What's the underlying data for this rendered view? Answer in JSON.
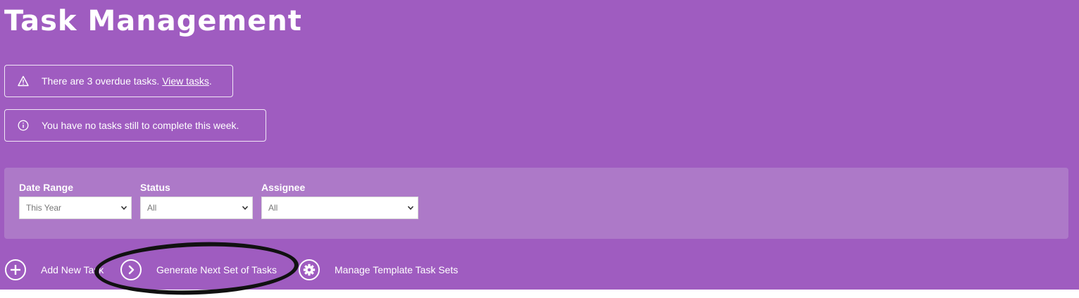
{
  "header": {
    "title": "Task Management"
  },
  "alerts": {
    "overdue": {
      "prefix": "There are 3 overdue tasks. ",
      "link": "View tasks",
      "suffix": "."
    },
    "info": {
      "text": "You have no tasks still to complete this week."
    }
  },
  "filters": {
    "date_range": {
      "label": "Date Range",
      "value": "This Year"
    },
    "status": {
      "label": "Status",
      "value": "All"
    },
    "assignee": {
      "label": "Assignee",
      "value": "All"
    }
  },
  "actions": {
    "add_task": "Add New Task",
    "generate": "Generate Next Set of Tasks",
    "manage": "Manage Template Task Sets"
  },
  "icons": {
    "alert": "warning-icon",
    "info": "info-icon",
    "add": "plus-circle-icon",
    "generate": "chevron-right-circle-icon",
    "manage": "gear-icon",
    "select": "chevron-down-icon"
  },
  "colors": {
    "background": "#9f5cc0",
    "panel": "#ad79c8",
    "annotation": "#111111"
  }
}
